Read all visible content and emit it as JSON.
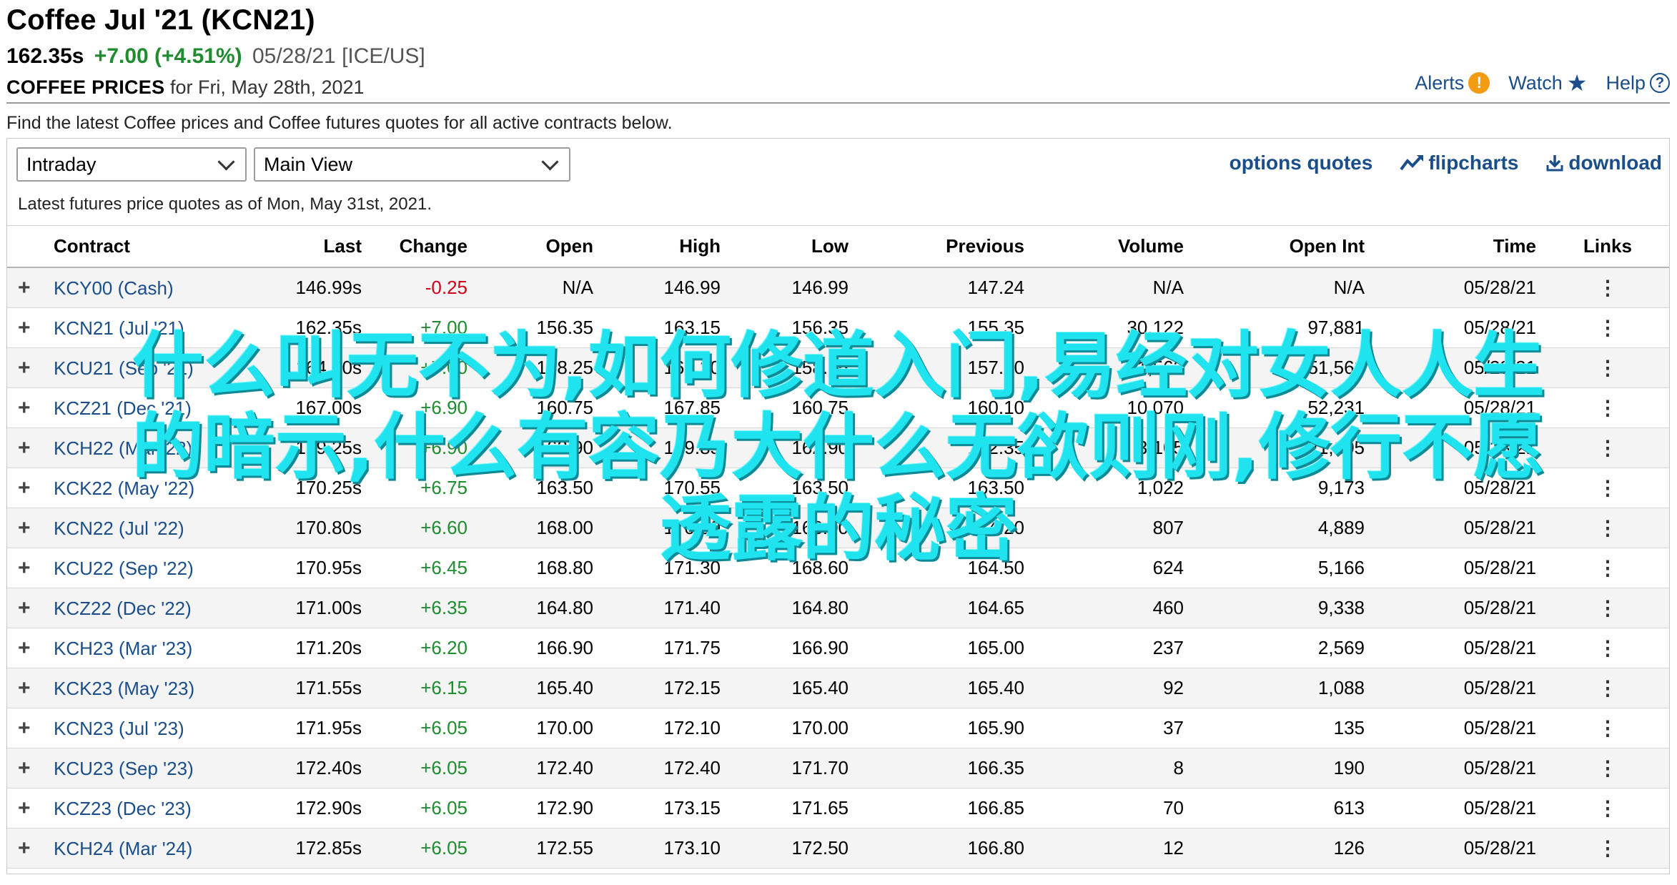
{
  "header": {
    "title": "Coffee Jul '21 (KCN21)",
    "last": "162.35s",
    "change": "+7.00 (+4.51%)",
    "date_exchange": "05/28/21 [ICE/US]",
    "prices_label": "COFFEE PRICES",
    "prices_date": " for Fri, May 28th, 2021"
  },
  "top_links": {
    "alerts": "Alerts",
    "watch": "Watch",
    "help": "Help"
  },
  "description": "Find the latest Coffee prices and Coffee futures quotes for all active contracts below.",
  "controls": {
    "period_select": "Intraday",
    "view_select": "Main View",
    "options_quotes": "options quotes",
    "flipcharts": "flipcharts",
    "download": "download"
  },
  "as_of": "Latest futures price quotes as of Mon, May 31st, 2021.",
  "colors": {
    "link": "#1a4e8a",
    "positive": "#1f8c2f",
    "negative": "#d0021b",
    "alert": "#f39c12",
    "overlay": "#1fe3ee"
  },
  "table": {
    "headers": [
      "Contract",
      "Last",
      "Change",
      "Open",
      "High",
      "Low",
      "Previous",
      "Volume",
      "Open Int",
      "Time",
      "Links"
    ],
    "rows": [
      [
        "KCY00 (Cash)",
        "146.99s",
        "-0.25",
        "N/A",
        "146.99",
        "146.99",
        "147.24",
        "N/A",
        "N/A",
        "05/28/21"
      ],
      [
        "KCN21 (Jul '21)",
        "162.35s",
        "+7.00",
        "156.35",
        "163.15",
        "156.35",
        "155.35",
        "30,122",
        "97,881",
        "05/28/21"
      ],
      [
        "KCU21 (Sep '21)",
        "164.30s",
        "+7.00",
        "158.25",
        "165.20",
        "158.25",
        "157.30",
        "11,562",
        "51,562",
        "05/28/21"
      ],
      [
        "KCZ21 (Dec '21)",
        "167.00s",
        "+6.90",
        "160.75",
        "167.85",
        "160.75",
        "160.10",
        "10,070",
        "52,231",
        "05/28/21"
      ],
      [
        "KCH22 (Mar '22)",
        "169.25s",
        "+6.90",
        "162.90",
        "169.85",
        "162.90",
        "162.35",
        "3,105",
        "21,105",
        "05/28/21"
      ],
      [
        "KCK22 (May '22)",
        "170.25s",
        "+6.75",
        "163.50",
        "170.55",
        "163.50",
        "163.50",
        "1,022",
        "9,173",
        "05/28/21"
      ],
      [
        "KCN22 (Jul '22)",
        "170.80s",
        "+6.60",
        "168.00",
        "170.90",
        "168.00",
        "164.20",
        "807",
        "4,889",
        "05/28/21"
      ],
      [
        "KCU22 (Sep '22)",
        "170.95s",
        "+6.45",
        "168.80",
        "171.30",
        "168.60",
        "164.50",
        "624",
        "5,166",
        "05/28/21"
      ],
      [
        "KCZ22 (Dec '22)",
        "171.00s",
        "+6.35",
        "164.80",
        "171.40",
        "164.80",
        "164.65",
        "460",
        "9,338",
        "05/28/21"
      ],
      [
        "KCH23 (Mar '23)",
        "171.20s",
        "+6.20",
        "166.90",
        "171.75",
        "166.90",
        "165.00",
        "237",
        "2,569",
        "05/28/21"
      ],
      [
        "KCK23 (May '23)",
        "171.55s",
        "+6.15",
        "165.40",
        "172.15",
        "165.40",
        "165.40",
        "92",
        "1,088",
        "05/28/21"
      ],
      [
        "KCN23 (Jul '23)",
        "171.95s",
        "+6.05",
        "170.00",
        "172.10",
        "170.00",
        "165.90",
        "37",
        "135",
        "05/28/21"
      ],
      [
        "KCU23 (Sep '23)",
        "172.40s",
        "+6.05",
        "172.40",
        "172.40",
        "171.70",
        "166.35",
        "8",
        "190",
        "05/28/21"
      ],
      [
        "KCZ23 (Dec '23)",
        "172.90s",
        "+6.05",
        "172.90",
        "173.15",
        "171.65",
        "166.85",
        "70",
        "613",
        "05/28/21"
      ],
      [
        "KCH24 (Mar '24)",
        "172.85s",
        "+6.05",
        "172.55",
        "173.10",
        "172.50",
        "166.80",
        "12",
        "126",
        "05/28/21"
      ]
    ]
  },
  "overlay": {
    "lines": [
      "什么叫无不为,如何修道入门,易经对女人人生",
      "的暗示,什么有容乃大什么无欲则刚,修行不愿",
      "透露的秘密"
    ]
  }
}
